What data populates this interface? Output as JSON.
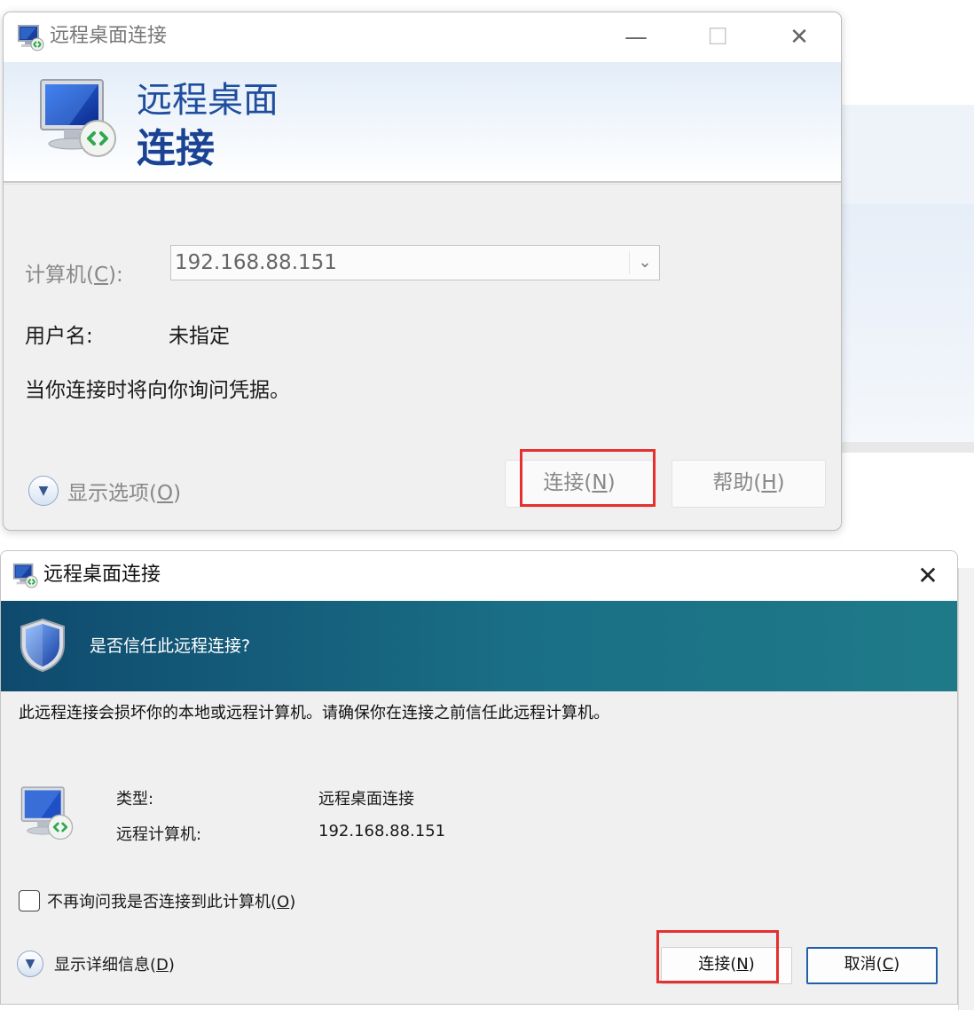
{
  "window1": {
    "title": "远程桌面连接",
    "heading_line1": "远程桌面",
    "heading_line2": "连接",
    "computer_label": "计算机(",
    "computer_label_key": "C",
    "computer_label_end": "):",
    "computer_value": "192.168.88.151",
    "username_label": "用户名:",
    "username_value": "未指定",
    "prompt": "当你连接时将向你询问凭据。",
    "show_options_label": "显示选项(",
    "show_options_key": "O",
    "show_options_end": ")",
    "connect_button": "连接(",
    "connect_key": "N",
    "connect_end": ")",
    "help_button": "帮助(",
    "help_key": "H",
    "help_end": ")"
  },
  "window2": {
    "title": "远程桌面连接",
    "question": "是否信任此远程连接?",
    "warning": "此远程连接会损坏你的本地或远程计算机。请确保你在连接之前信任此远程计算机。",
    "type_label": "类型:",
    "type_value": "远程桌面连接",
    "remote_computer_label": "远程计算机:",
    "remote_computer_value": "192.168.88.151",
    "dont_ask_label": "不再询问我是否连接到此计算机(",
    "dont_ask_key": "O",
    "dont_ask_end": ")",
    "dont_ask_checked": false,
    "show_details_label": "显示详细信息(",
    "show_details_key": "D",
    "show_details_end": ")",
    "connect_button": "连接(",
    "connect_key": "N",
    "connect_end": ")",
    "cancel_button": "取消(",
    "cancel_key": "C",
    "cancel_end": ")"
  },
  "icons": {
    "app": "remote-desktop-icon",
    "shield": "shield-icon",
    "expand": "chevron-down-icon",
    "close": "close-icon",
    "minimize": "minimize-icon",
    "maximize": "maximize-icon",
    "dropdown": "chevron-down-icon"
  },
  "colors": {
    "heading_blue": "#1a4394",
    "trust_banner": "#1a6f86",
    "highlight_red": "#e53030"
  }
}
